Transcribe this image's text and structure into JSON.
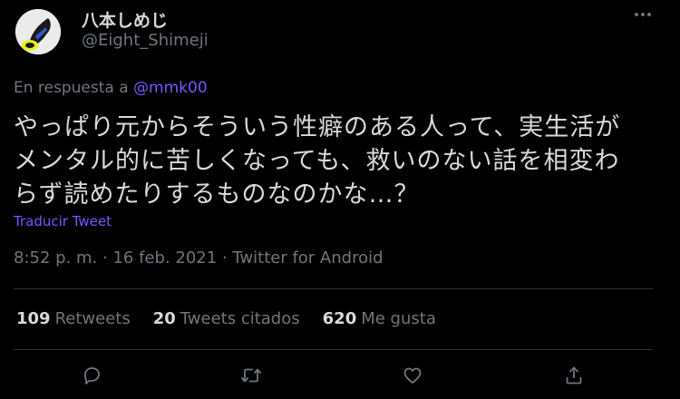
{
  "user": {
    "display_name": "八本しめじ",
    "handle": "@Eight_Shimeji",
    "avatar_icon": "shimeji-avatar"
  },
  "reply": {
    "prefix": "En respuesta a",
    "mention": "@mmk00"
  },
  "tweet": {
    "lines": [
      "やっぱり元からそういう性癖のある人って、実生活が",
      "メンタル的に苦しくなっても、救いのない話を相変わ",
      "らず読めたりするものなのかな…？"
    ]
  },
  "translate_label": "Traducir Tweet",
  "meta": {
    "time": "8:52 p. m.",
    "date": "16 feb. 2021",
    "source": "Twitter for Android",
    "separator": "·"
  },
  "stats": {
    "retweets": {
      "count": "109",
      "label": "Retweets"
    },
    "quotes": {
      "count": "20",
      "label": "Tweets citados"
    },
    "likes": {
      "count": "620",
      "label": "Me gusta"
    }
  },
  "actions": [
    "reply-icon",
    "retweet-icon",
    "like-icon",
    "share-icon"
  ],
  "colors": {
    "background": "#000000",
    "text": "#d9d9d9",
    "secondary": "#6e767d",
    "accent": "#7856ff",
    "divider": "#2f3336"
  }
}
